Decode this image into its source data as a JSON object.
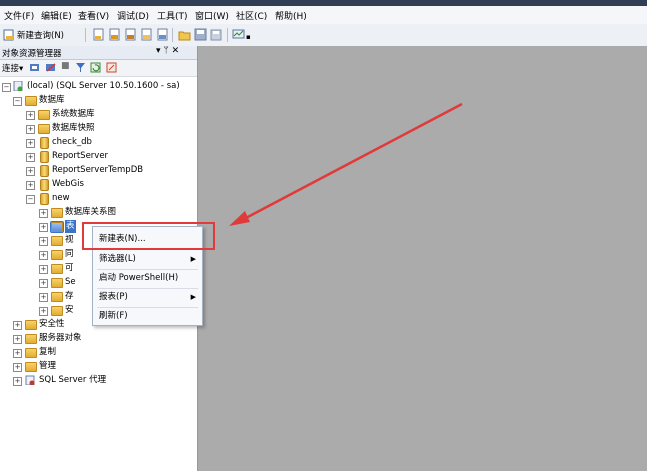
{
  "menu": [
    "文件(F)",
    "编辑(E)",
    "查看(V)",
    "调试(D)",
    "工具(T)",
    "窗口(W)",
    "社区(C)",
    "帮助(H)"
  ],
  "toolbar": {
    "new_query_label": "新建查询(N)"
  },
  "explorer": {
    "title": "对象资源管理器",
    "pin": "▾ ᛘ ✕",
    "connect_label": "连接▾"
  },
  "tree": {
    "server": "(local) (SQL Server 10.50.1600 - sa)",
    "databases": "数据库",
    "system_databases": "系统数据库",
    "snapshots": "数据库快照",
    "db_check": "check_db",
    "db_report": "ReportServer",
    "db_reporttemp": "ReportServerTempDB",
    "db_webgis": "WebGis",
    "db_new": "new",
    "new_children": {
      "diagrams": "数据库关系图",
      "tables": "表",
      "views": "视",
      "synonyms": "同",
      "programmability": "可",
      "service_broker": "Se",
      "storage": "存",
      "security": "安"
    },
    "security": "安全性",
    "server_objects": "服务器对象",
    "replication": "复制",
    "management": "管理",
    "agent": "SQL Server 代理"
  },
  "context_menu": {
    "new_table": "新建表(N)...",
    "filter": "筛选器(L)",
    "powershell": "启动 PowerShell(H)",
    "reports": "报表(P)",
    "refresh": "刷新(F)"
  },
  "colors": {
    "highlight": "#e03a3a",
    "workspace": "#ababab"
  }
}
